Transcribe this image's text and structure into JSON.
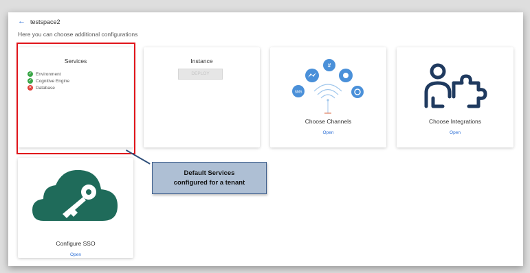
{
  "header": {
    "back_icon": "arrow-left-icon",
    "title": "testspace2"
  },
  "subtitle": "Here you can choose additional configurations",
  "cards": {
    "services": {
      "title": "Services",
      "items": [
        {
          "label": "Environment",
          "status": "ok"
        },
        {
          "label": "Cognitive Engine",
          "status": "ok"
        },
        {
          "label": "Database",
          "status": "error"
        }
      ]
    },
    "instance": {
      "title": "Instance",
      "button": "DEPLOY"
    },
    "channels": {
      "title": "Choose Channels",
      "link": "Open"
    },
    "integrations": {
      "title": "Choose Integrations",
      "link": "Open"
    },
    "sso": {
      "title": "Configure SSO",
      "link": "Open"
    }
  },
  "callout": {
    "line1": "Default Services",
    "line2": "configured for a tenant"
  },
  "colors": {
    "accent": "#2c6fd6",
    "ok": "#3aa648",
    "error": "#e0403a",
    "highlight": "#e0141a",
    "channel_icons": "#4a90d9",
    "integration_icon": "#1f3a5f",
    "sso_cloud": "#1f6b5a"
  }
}
